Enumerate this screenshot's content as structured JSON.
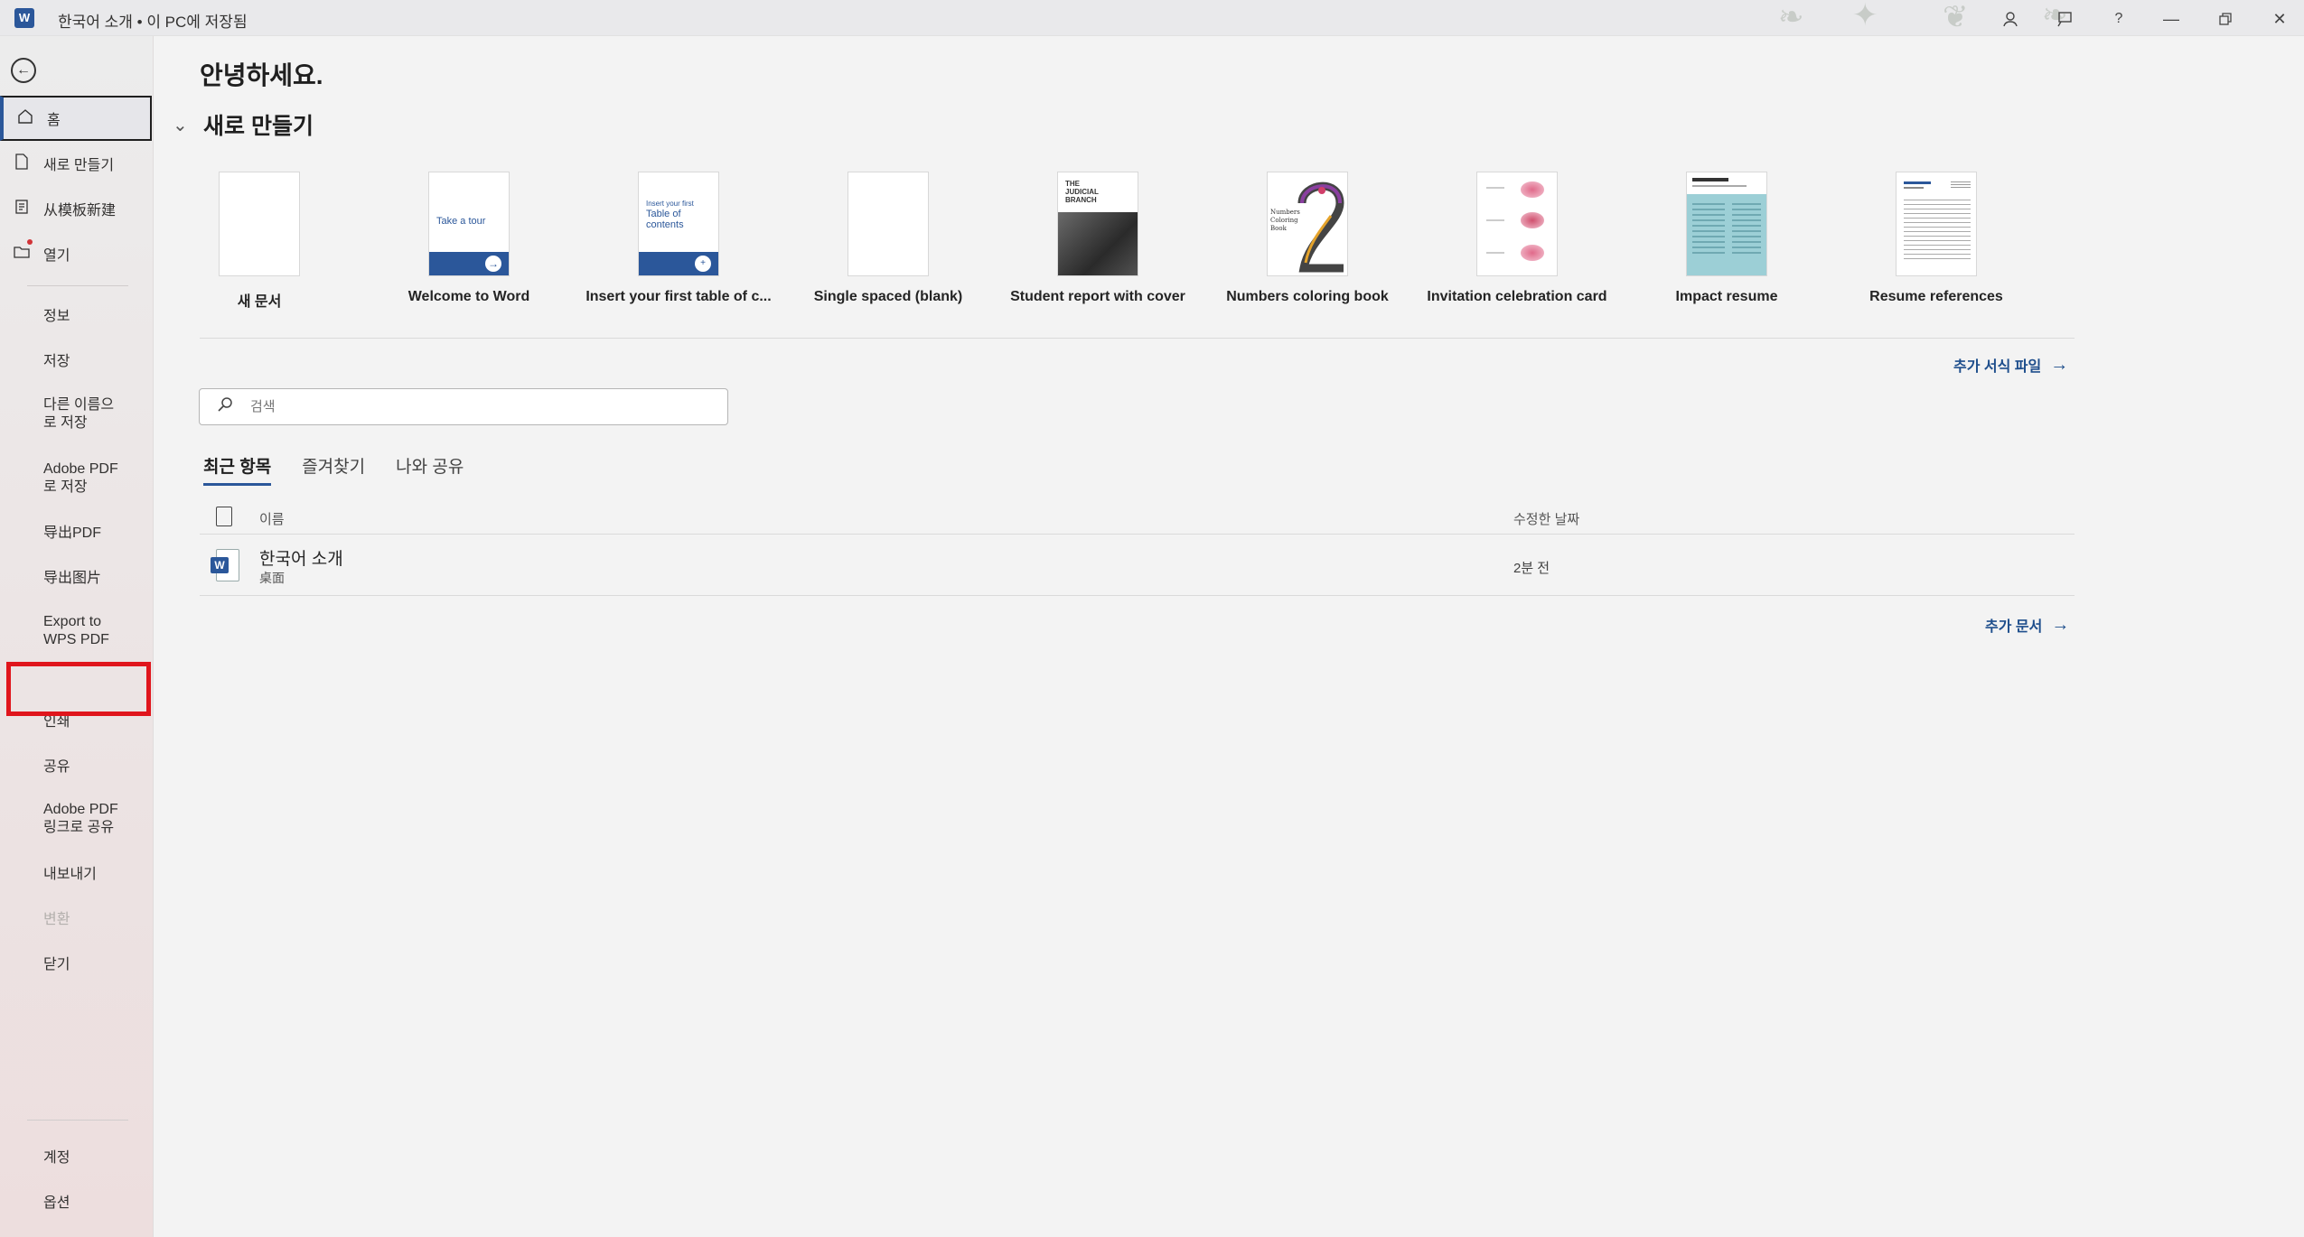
{
  "titlebar": {
    "app_icon": "word-icon",
    "title": "한국어 소개 • 이 PC에 저장됨"
  },
  "sidebar": {
    "items": [
      {
        "label": "홈",
        "icon": "home-icon"
      },
      {
        "label": "새로 만들기",
        "icon": "new-doc-icon"
      },
      {
        "label": "从模板新建",
        "icon": "template-icon"
      },
      {
        "label": "열기",
        "icon": "folder-icon"
      },
      {
        "label": "정보"
      },
      {
        "label": "저장"
      },
      {
        "label": "다른 이름으로 저장"
      },
      {
        "label": "Adobe PDF로 저장"
      },
      {
        "label": "导出PDF"
      },
      {
        "label": "导出图片"
      },
      {
        "label": "Export to WPS PDF"
      },
      {
        "label": "인쇄"
      },
      {
        "label": "공유"
      },
      {
        "label": "Adobe PDF 링크로 공유"
      },
      {
        "label": "내보내기"
      },
      {
        "label": "변환"
      },
      {
        "label": "닫기"
      },
      {
        "label": "계정"
      },
      {
        "label": "옵션"
      }
    ]
  },
  "main": {
    "greeting": "안녕하세요.",
    "new_section_title": "새로 만들기",
    "templates": [
      {
        "label": "새 문서"
      },
      {
        "label": "Welcome to Word",
        "thumb_text": "Take a tour"
      },
      {
        "label": "Insert your first table of c...",
        "thumb_text_1": "Insert your first",
        "thumb_text_2": "Table of contents"
      },
      {
        "label": "Single spaced (blank)"
      },
      {
        "label": "Student report with cover",
        "thumb_text": "THE JUDICIAL BRANCH"
      },
      {
        "label": "Numbers coloring book",
        "thumb_text": "Numbers Coloring Book"
      },
      {
        "label": "Invitation celebration card"
      },
      {
        "label": "Impact resume"
      },
      {
        "label": "Resume references"
      }
    ],
    "more_templates": "추가 서식 파일",
    "search_placeholder": "검색",
    "tabs": [
      "최근 항목",
      "즐겨찾기",
      "나와 공유"
    ],
    "table": {
      "col_name": "이름",
      "col_modified": "수정한 날짜",
      "rows": [
        {
          "name": "한국어 소개",
          "location": "桌面",
          "modified": "2분 전"
        }
      ]
    },
    "more_documents": "추가 문서"
  },
  "colors": {
    "accent": "#2b579a",
    "highlight": "#e0151c",
    "link": "#1e4e8c"
  }
}
